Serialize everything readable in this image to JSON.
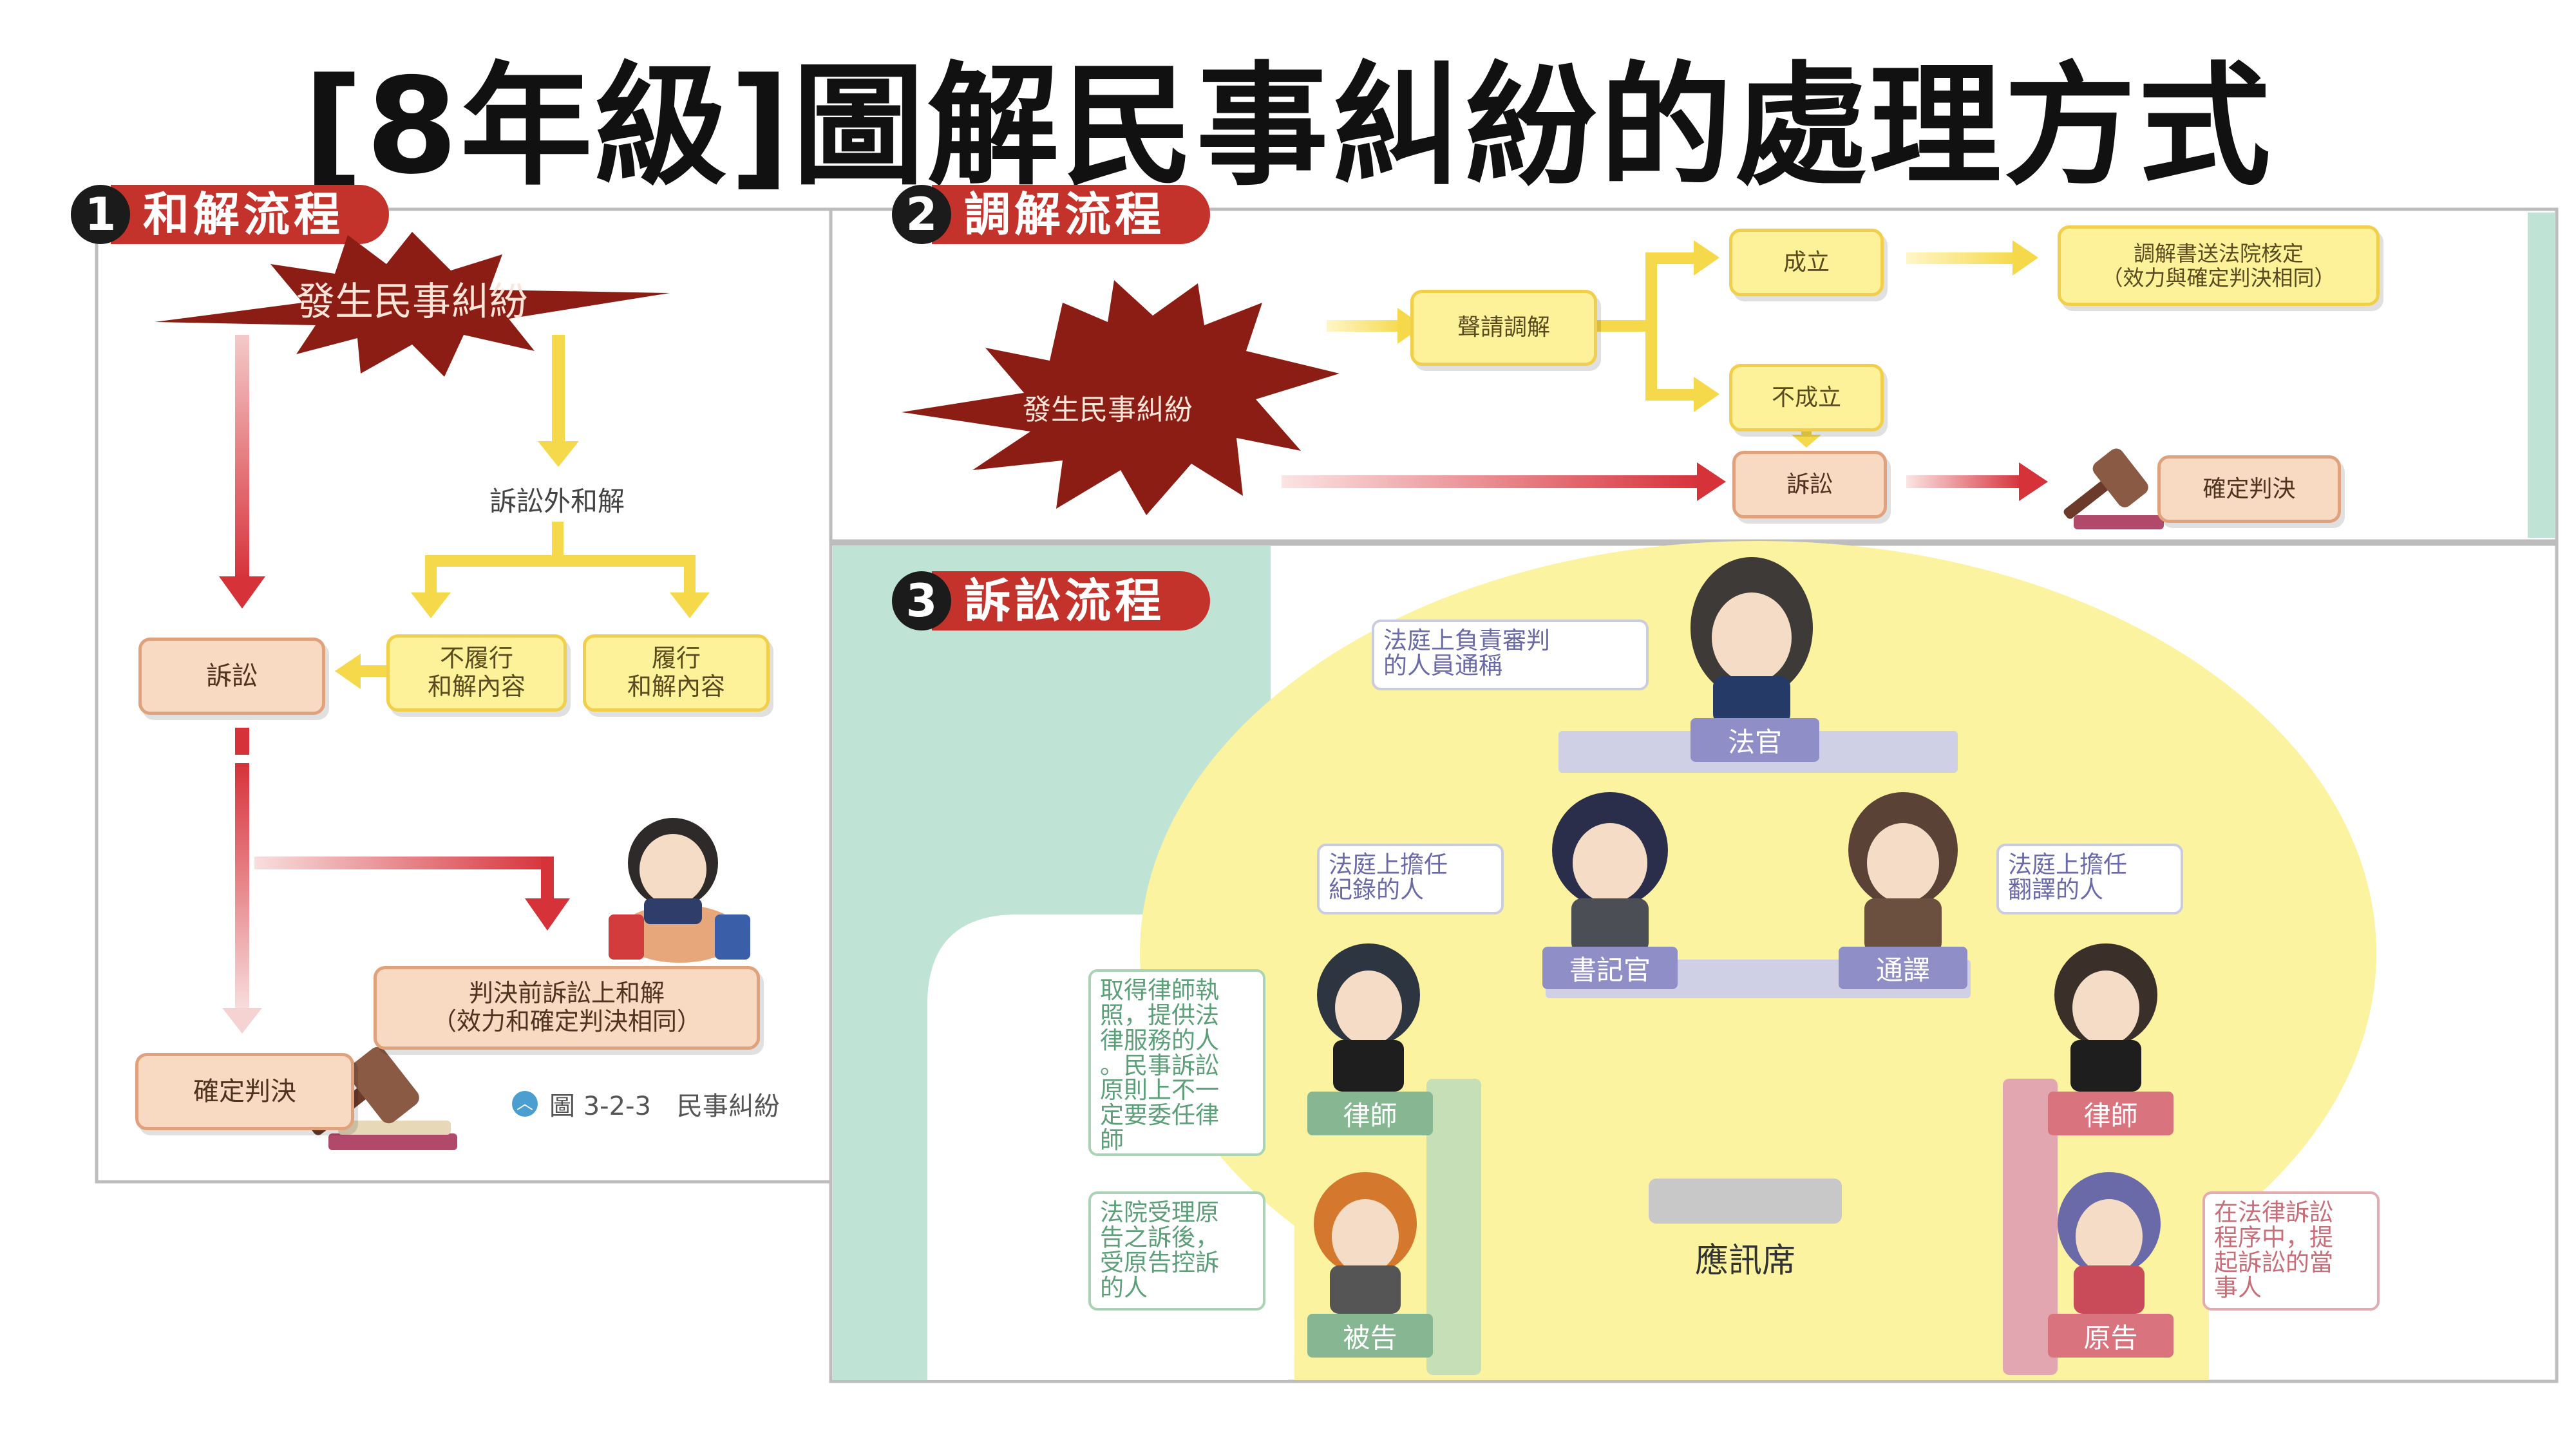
{
  "title": "[8年級]圖解民事糾紛的處理方式",
  "section1": {
    "number": "1",
    "label": "和解流程",
    "burst": "發生民事糾紛",
    "out_of_court": "訴訟外和解",
    "not_fulfill": "不履行\n和解內容",
    "fulfill": "履行\n和解內容",
    "lawsuit": "訴訟",
    "pre_judgment": "判決前訴訟上和解\n（效力和確定判決相同）",
    "final": "確定判決",
    "caption": "圖 3-2-3　民事糾紛"
  },
  "section2": {
    "number": "2",
    "label": "調解流程",
    "burst": "發生民事糾紛",
    "apply": "聲請調解",
    "success": "成立",
    "success_result": "調解書送法院核定\n（效力與確定判決相同）",
    "fail": "不成立",
    "lawsuit": "訴訟",
    "final": "確定判決"
  },
  "section3": {
    "number": "3",
    "label": "訴訟流程",
    "judge_note": "法庭上負責審判\n的人員通稱",
    "judge": "法官",
    "clerk_note": "法庭上擔任\n紀錄的人",
    "clerk": "書記官",
    "interpreter_note": "法庭上擔任\n翻譯的人",
    "interpreter": "通譯",
    "lawyer_note": "取得律師執\n照，提供法\n律服務的人\n。民事訴訟\n原則上不一\n定要委任律\n師",
    "lawyer_left": "律師",
    "lawyer_right": "律師",
    "defendant_note": "法院受理原\n告之訴後，\n受原告控訴\n的人",
    "defendant": "被告",
    "plaintiff_note": "在法律訴訟\n程序中，提\n起訴訟的當\n事人",
    "plaintiff": "原告",
    "stand": "應訊席"
  },
  "colors": {
    "accent_red": "#c4332b",
    "burst": "#8b1d14",
    "yellow_arrow": "#f5d94a",
    "court_yellow": "#fbf3a0",
    "mint": "#bfe3d4"
  }
}
